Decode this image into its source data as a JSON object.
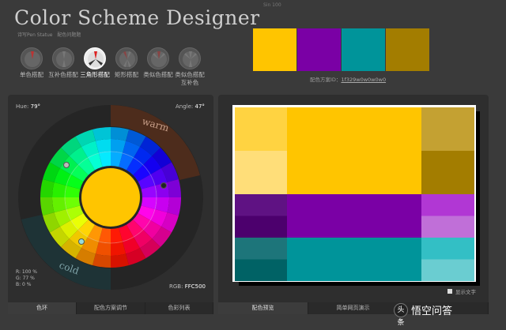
{
  "header": {
    "title": "Color Scheme Designer",
    "version": "Sin 100",
    "subtitle_links": [
      "诗写Pen Statue",
      "配色问题题"
    ]
  },
  "modes": [
    {
      "label": "单色搭配",
      "icon": "monochrome-icon"
    },
    {
      "label": "互补色搭配",
      "icon": "complement-icon"
    },
    {
      "label": "三角形搭配",
      "icon": "triad-icon",
      "active": true
    },
    {
      "label": "矩形搭配",
      "icon": "tetrad-icon"
    },
    {
      "label": "类似色搭配",
      "icon": "analogic-icon"
    },
    {
      "label": "类似色搭配互补色",
      "icon": "accented-analogic-icon"
    }
  ],
  "preview_swatches": [
    "#FFC500",
    "#7A00A5",
    "#00949A",
    "#A37D00"
  ],
  "scheme_id": {
    "label": "配色方案ID：",
    "value": "1f329w0w0w0w0"
  },
  "wheel": {
    "hue_label": "Hue:",
    "hue_value": "79°",
    "angle_label": "Angle:",
    "angle_value": "47°",
    "warm": "warm",
    "cold": "cold",
    "rgb_values": [
      "R: 100 %",
      "G:  77 %",
      "B:    0 %"
    ],
    "rgb_hex_label": "RGB:",
    "rgb_hex": "FFC500",
    "center_color": "#FFC500"
  },
  "preview_grid": {
    "rows": [
      {
        "side": [
          "#FFD341",
          "#FFDE79"
        ],
        "main": "#FFC500",
        "right": [
          "#C4A132",
          "#A37D00"
        ]
      },
      {
        "side": [
          "#5F1283",
          "#4C006D"
        ],
        "main": "#7A00A5",
        "right": [
          "#B137D4",
          "#C06FD8"
        ]
      },
      {
        "side": [
          "#1D757A",
          "#006265"
        ],
        "main": "#00949A",
        "right": [
          "#33BFC5",
          "#6ACDD1"
        ]
      }
    ]
  },
  "left_tabs": [
    "色环",
    "配色方案调节",
    "色彩列表"
  ],
  "right_tabs": [
    "配色预览",
    "简单网页演示",
    ""
  ],
  "show_text": "显示文字",
  "watermark": {
    "logo": "头条",
    "text": "悟空问答"
  }
}
